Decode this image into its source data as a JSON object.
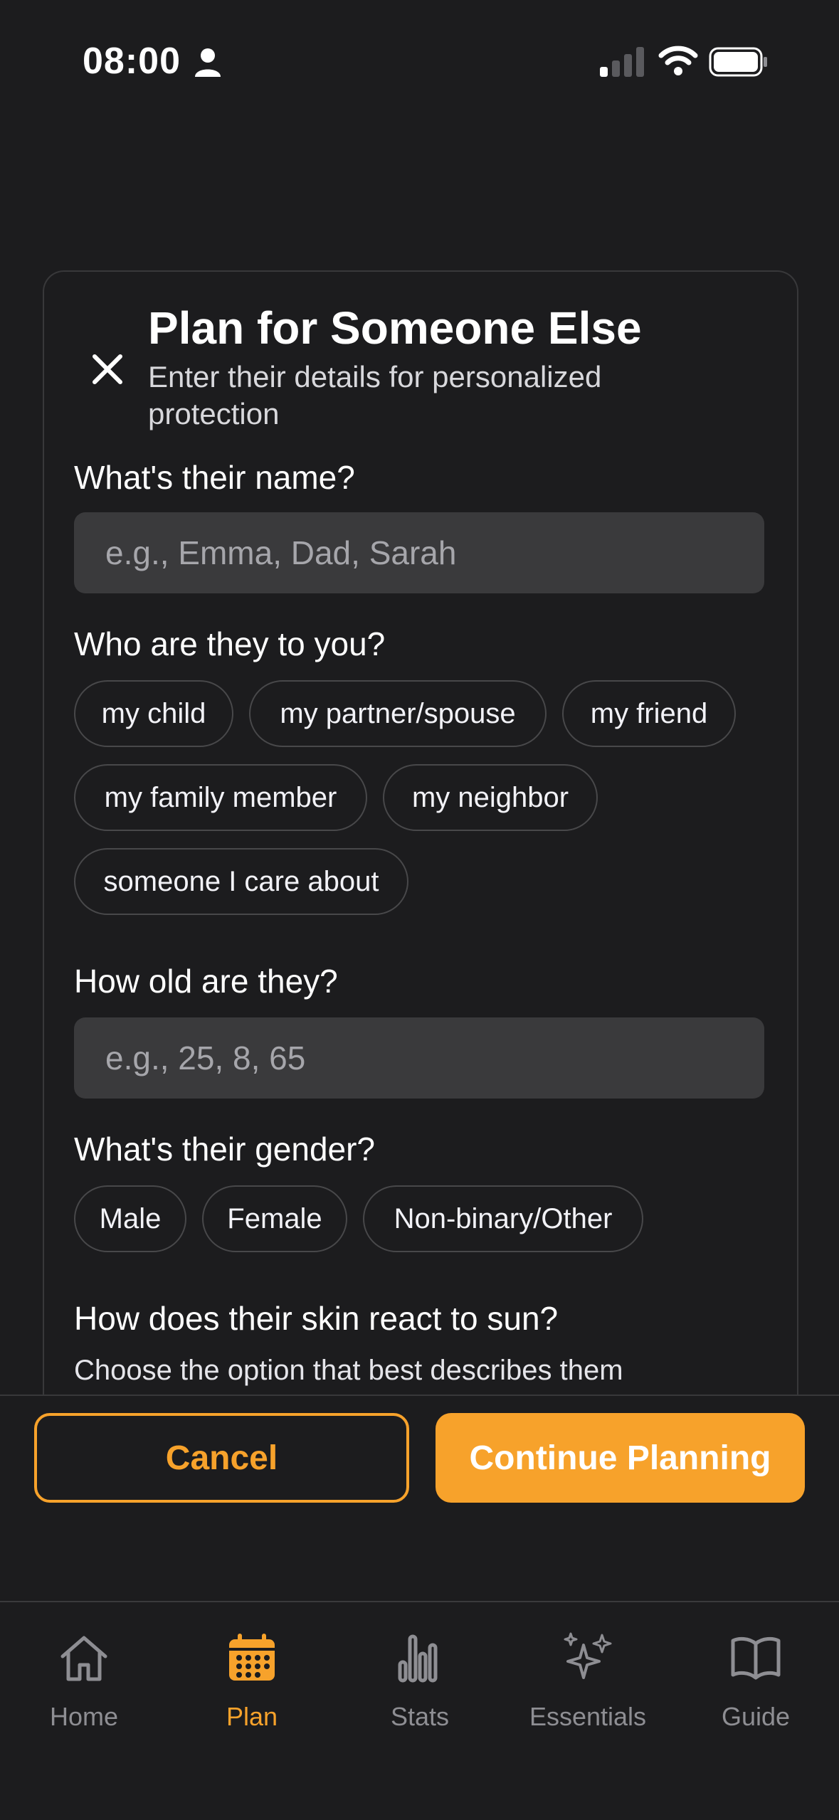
{
  "status_bar": {
    "time": "08:00"
  },
  "modal": {
    "title": "Plan for Someone Else",
    "subtitle": "Enter their details for personalized protection",
    "name_section": {
      "label": "What's their name?",
      "placeholder": "e.g., Emma, Dad, Sarah"
    },
    "relation_section": {
      "label": "Who are they to you?",
      "options": [
        "my child",
        "my partner/spouse",
        "my friend",
        "my family member",
        "my neighbor",
        "someone I care about"
      ]
    },
    "age_section": {
      "label": "How old are they?",
      "placeholder": "e.g., 25, 8, 65"
    },
    "gender_section": {
      "label": "What's their gender?",
      "options": [
        "Male",
        "Female",
        "Non-binary/Other"
      ]
    },
    "skin_section": {
      "label": "How does their skin react to sun?",
      "helper": "Choose the option that best describes them"
    }
  },
  "footer": {
    "cancel_label": "Cancel",
    "continue_label": "Continue Planning"
  },
  "tab_bar": {
    "items": [
      {
        "label": "Home",
        "icon": "home-icon"
      },
      {
        "label": "Plan",
        "icon": "calendar-icon",
        "active": true
      },
      {
        "label": "Stats",
        "icon": "bar-chart-icon"
      },
      {
        "label": "Essentials",
        "icon": "sparkles-icon"
      },
      {
        "label": "Guide",
        "icon": "book-icon"
      }
    ]
  },
  "colors": {
    "accent": "#f7a22b",
    "background": "#1c1c1e",
    "field": "#3a3a3c",
    "inactive": "#8e8e93"
  }
}
